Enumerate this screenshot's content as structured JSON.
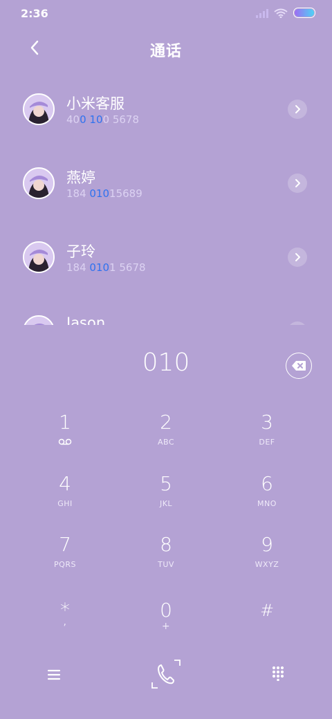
{
  "status": {
    "time": "2:36",
    "icons": [
      "signal-icon",
      "wifi-icon",
      "battery-icon"
    ]
  },
  "header": {
    "title": "通话",
    "back_icon": "chevron-left-icon"
  },
  "contacts": [
    {
      "name": "小米客服",
      "number_parts": [
        {
          "text": "40",
          "highlight": false
        },
        {
          "text": "0",
          "highlight": true
        },
        {
          "text": " ",
          "highlight": false
        },
        {
          "text": "10",
          "highlight": true
        },
        {
          "text": "0 5678",
          "highlight": false
        }
      ]
    },
    {
      "name": "燕婷",
      "number_parts": [
        {
          "text": "184 ",
          "highlight": false
        },
        {
          "text": "010",
          "highlight": true
        },
        {
          "text": "15689",
          "highlight": false
        }
      ]
    },
    {
      "name": "子玲",
      "number_parts": [
        {
          "text": "184 ",
          "highlight": false
        },
        {
          "text": "010",
          "highlight": true
        },
        {
          "text": "1 5678",
          "highlight": false
        }
      ]
    },
    {
      "name": "Jason",
      "number_parts": []
    }
  ],
  "dial": {
    "number": "010",
    "backspace_icon": "backspace-icon"
  },
  "keypad": [
    {
      "digit": "1",
      "letters": "",
      "icon": "voicemail-icon"
    },
    {
      "digit": "2",
      "letters": "ABC"
    },
    {
      "digit": "3",
      "letters": "DEF"
    },
    {
      "digit": "4",
      "letters": "GHI"
    },
    {
      "digit": "5",
      "letters": "JKL"
    },
    {
      "digit": "6",
      "letters": "MNO"
    },
    {
      "digit": "7",
      "letters": "PQRS"
    },
    {
      "digit": "8",
      "letters": "TUV"
    },
    {
      "digit": "9",
      "letters": "WXYZ"
    },
    {
      "digit": "*",
      "letters": ","
    },
    {
      "digit": "0",
      "letters": "+"
    },
    {
      "digit": "#",
      "letters": ""
    }
  ],
  "bottom_bar": {
    "icons": [
      "menu-icon",
      "phone-call-icon",
      "dialpad-icon"
    ]
  },
  "colors": {
    "background": "#b4a2d4",
    "highlight": "#2f72ef",
    "text": "#ffffff"
  }
}
